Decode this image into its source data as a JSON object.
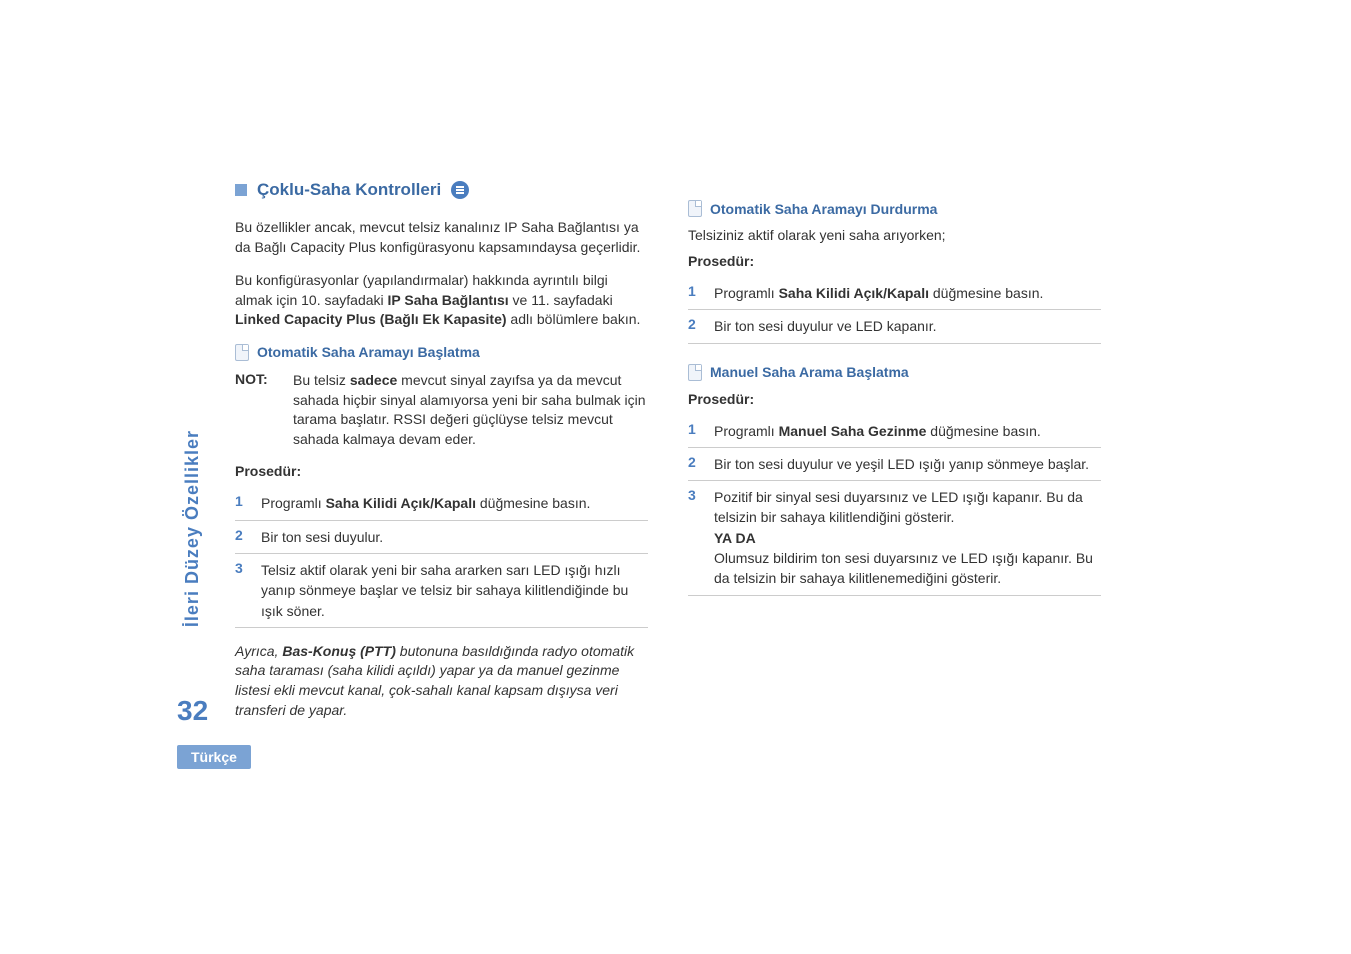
{
  "sidebar": {
    "section_label": "İleri Düzey Özellikler",
    "page_number": "32",
    "language": "Türkçe"
  },
  "left": {
    "main_heading": "Çoklu-Saha Kontrolleri",
    "para1_pre": "Bu özellikler ancak, mevcut telsiz kanalınız IP Saha Bağlantısı ya da Bağlı Capacity Plus konfigürasyonu kapsamındaysa geçerlidir.",
    "para2_a": "Bu konfigürasyonlar (yapılandırmalar) hakkında ayrıntılı bilgi almak için 10. sayfadaki ",
    "para2_b1": "IP Saha Bağlantısı",
    "para2_c": " ve 11. sayfadaki ",
    "para2_b2": "Linked Capacity Plus (Bağlı Ek Kapasite)",
    "para2_d": " adlı bölümlere bakın.",
    "sub1": "Otomatik Saha Aramayı Başlatma",
    "note_label": "NOT:",
    "note_a": "Bu telsiz ",
    "note_b": "sadece",
    "note_c": " mevcut sinyal zayıfsa ya da mevcut sahada hiçbir sinyal alamıyorsa yeni bir saha bulmak için tarama başlatır. RSSI değeri güçlüyse telsiz mevcut sahada kalmaya devam eder.",
    "proc": "Prosedür:",
    "s1_a": "Programlı ",
    "s1_b": "Saha Kilidi Açık/Kapalı",
    "s1_c": " düğmesine basın.",
    "s2": "Bir ton sesi duyulur.",
    "s3": "Telsiz aktif olarak yeni bir saha ararken sarı LED ışığı hızlı yanıp sönmeye başlar ve telsiz bir sahaya kilitlendiğinde bu ışık söner.",
    "italic_a": "Ayrıca, ",
    "italic_b": "Bas-Konuş (PTT)",
    "italic_c": " butonuna basıldığında radyo otomatik saha taraması (saha kilidi açıldı) yapar ya da manuel gezinme listesi ekli mevcut kanal, çok-sahalı kanal kapsam dışıysa veri transferi de yapar."
  },
  "right": {
    "sub2": "Otomatik Saha Aramayı Durdurma",
    "intro2": "Telsiziniz aktif olarak yeni saha arıyorken;",
    "proc2": "Prosedür:",
    "r1_a": "Programlı ",
    "r1_b": "Saha Kilidi Açık/Kapalı",
    "r1_c": " düğmesine basın.",
    "r2": "Bir ton sesi duyulur ve LED kapanır.",
    "sub3": "Manuel Saha Arama Başlatma",
    "proc3": "Prosedür:",
    "m1_a": "Programlı ",
    "m1_b": "Manuel Saha Gezinme",
    "m1_c": " düğmesine basın.",
    "m2": "Bir ton sesi duyulur ve yeşil LED ışığı yanıp sönmeye başlar.",
    "m3_a": "Pozitif bir sinyal sesi duyarsınız ve LED ışığı kapanır. Bu da telsizin bir sahaya kilitlendiğini gösterir.",
    "m3_b": "YA DA",
    "m3_c": "Olumsuz bildirim ton sesi duyarsınız ve LED ışığı kapanır. Bu da telsizin bir sahaya kilitlenemediğini gösterir."
  }
}
